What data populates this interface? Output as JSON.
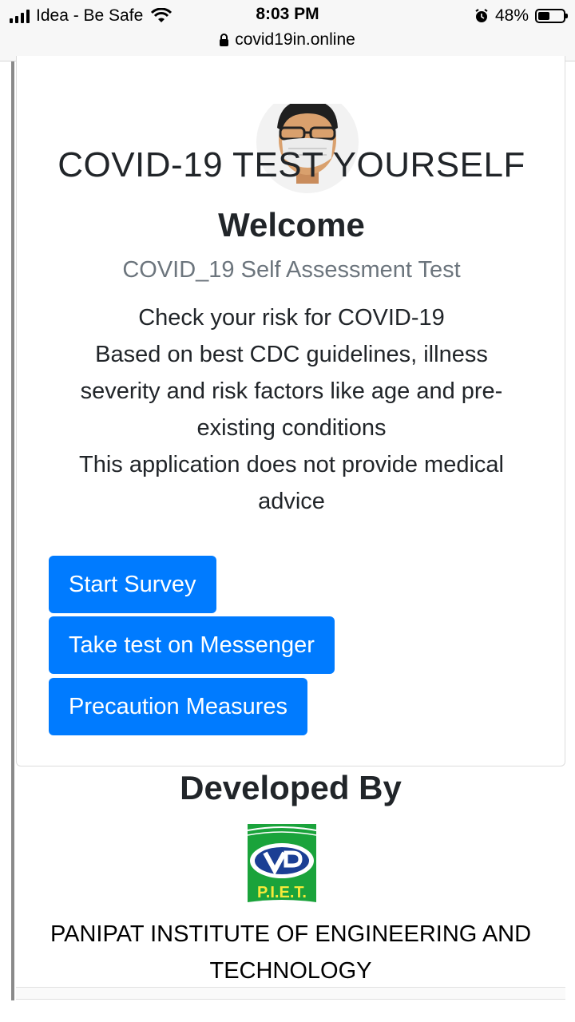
{
  "status_bar": {
    "carrier": "Idea - Be Safe",
    "time": "8:03 PM",
    "battery": "48%",
    "battery_level": 0.48,
    "url": "covid19in.online"
  },
  "card": {
    "title": "COVID-19 TEST YOURSELF",
    "welcome": "Welcome",
    "subtitle": "COVID_19 Self Assessment Test",
    "description": [
      "Check your risk for COVID-19",
      "Based on best CDC guidelines, illness severity and risk factors like age and pre-existing conditions",
      "This application does not provide medical advice"
    ],
    "buttons": {
      "start_survey": "Start Survey",
      "messenger": "Take test on Messenger",
      "precaution": "Precaution Measures"
    }
  },
  "footer": {
    "developed_by": "Developed By",
    "logo_text": "P.I.E.T.",
    "institute": "PANIPAT INSTITUTE OF ENGINEERING AND TECHNOLOGY"
  },
  "colors": {
    "primary": "#007bff",
    "muted": "#6c757d",
    "logo_green": "#1aa33b"
  }
}
